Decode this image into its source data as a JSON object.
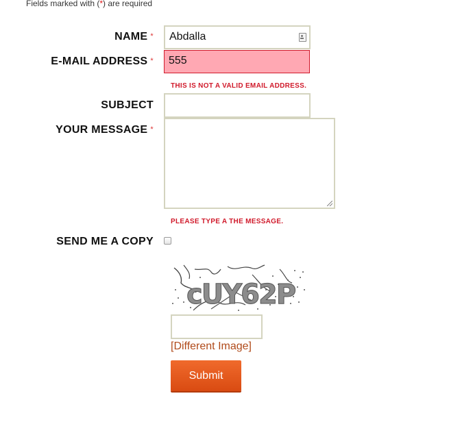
{
  "form": {
    "required_note": {
      "prefix": "Fields marked with ",
      "open": "(",
      "star": "*",
      "close": ")",
      "suffix": " are required"
    },
    "required_star": "*",
    "name": {
      "label": "NAME",
      "value": "Abdalla"
    },
    "email": {
      "label": "E-MAIL ADDRESS",
      "value": "555",
      "error": "THIS IS NOT A VALID EMAIL ADDRESS."
    },
    "subject": {
      "label": "SUBJECT",
      "value": ""
    },
    "message": {
      "label": "YOUR MESSAGE",
      "value": "",
      "error": "PLEASE TYPE A THE MESSAGE."
    },
    "send_copy": {
      "label": "SEND ME A COPY",
      "checked": false
    },
    "captcha": {
      "text": "cUY62P",
      "input_value": "",
      "refresh_link": "[Different Image]"
    },
    "submit_label": "Submit"
  },
  "colors": {
    "error_text": "#d0192a",
    "error_field_bg": "#ffa8b3",
    "link": "#b04a1a",
    "button": "#e55a1c"
  },
  "icons": {
    "name_field_icon": "contact-card-icon",
    "message_resize": "resize-grip-icon"
  }
}
